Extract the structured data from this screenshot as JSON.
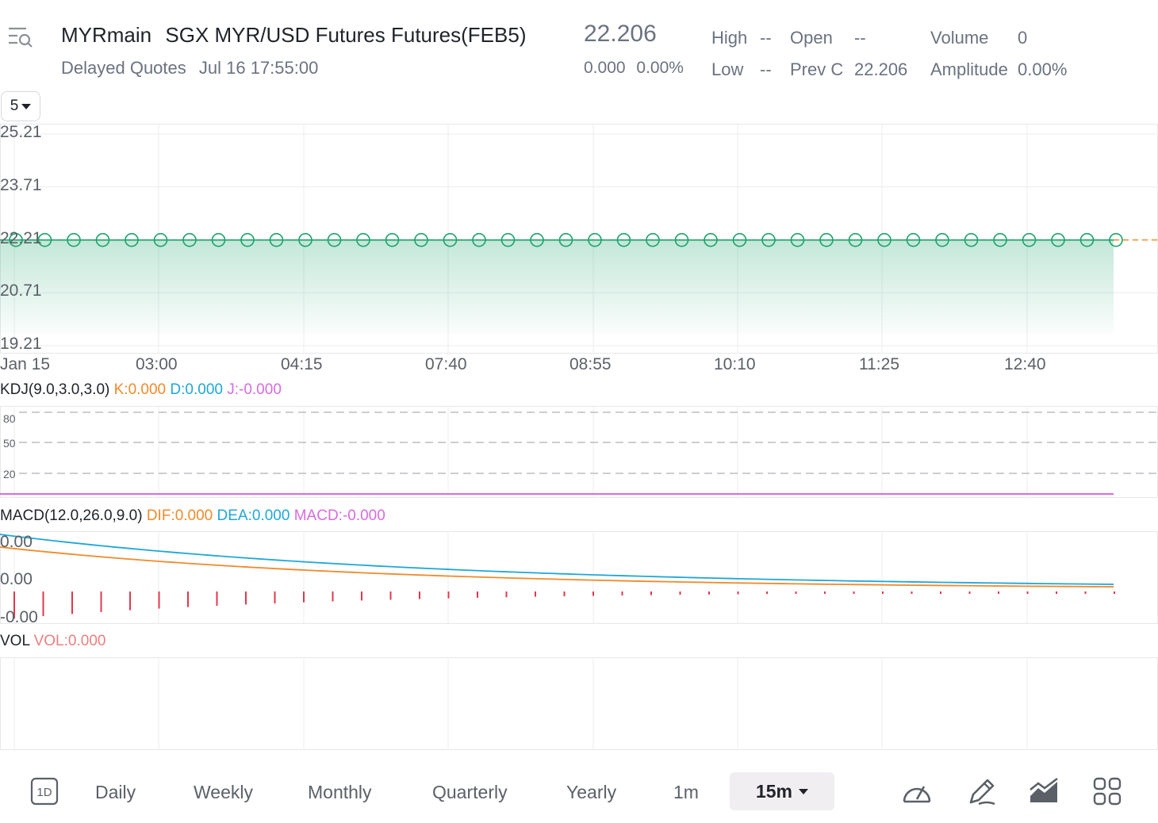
{
  "header": {
    "symbol": "MYRmain",
    "name": "SGX MYR/USD Futures Futures(FEB5)",
    "quote_type": "Delayed Quotes",
    "quote_time": "Jul 16 17:55:00",
    "last_price": "22.206",
    "change": "0.000",
    "change_pct": "0.00%",
    "stats": {
      "high_label": "High",
      "high_value": "--",
      "low_label": "Low",
      "low_value": "--",
      "open_label": "Open",
      "open_value": "--",
      "prev_close_label": "Prev C",
      "prev_close_value": "22.206",
      "volume_label": "Volume",
      "volume_value": "0",
      "amplitude_label": "Amplitude",
      "amplitude_value": "0.00%"
    }
  },
  "period_selector": {
    "value": "5"
  },
  "main_chart": {
    "y_ticks": [
      "25.21",
      "23.71",
      "22.21",
      "20.71",
      "19.21"
    ],
    "x_ticks": [
      "Jan 15",
      "03:00",
      "04:15",
      "07:40",
      "08:55",
      "10:10",
      "11:25",
      "12:40"
    ],
    "line_color": "#1aa36b",
    "prev_close_color": "#f08a2b"
  },
  "chart_data": [
    {
      "type": "line",
      "title": "",
      "x": [
        "Jan 15",
        "03:00",
        "04:15",
        "07:40",
        "08:55",
        "10:10",
        "11:25",
        "12:40"
      ],
      "series": [
        {
          "values": [
            22.206,
            22.206,
            22.206,
            22.206,
            22.206,
            22.206,
            22.206,
            22.206
          ]
        }
      ],
      "reference_line": 22.206,
      "ylim": [
        19.21,
        25.21
      ],
      "grid": true
    }
  ],
  "kdj": {
    "label": "KDJ(9.0,3.0,3.0)",
    "k": "K:0.000",
    "d": "D:0.000",
    "j": "J:-0.000",
    "k_color": "#f08a2b",
    "d_color": "#1fa7d8",
    "j_color": "#d86be0",
    "levels": [
      "80",
      "50",
      "20"
    ]
  },
  "macd": {
    "label": "MACD(12.0,26.0,9.0)",
    "dif": "DIF:0.000",
    "dea": "DEA:0.000",
    "macd": "MACD:-0.000",
    "dif_color": "#f08a2b",
    "dea_color": "#1fa7d8",
    "macd_color": "#d86be0",
    "y_ticks": [
      "0.00",
      "0.00",
      "-0.00"
    ]
  },
  "vol": {
    "label": "VOL",
    "vol": "VOL:0.000",
    "vol_color": "#e88080"
  },
  "toolbar": {
    "timeframes": [
      "Daily",
      "Weekly",
      "Monthly",
      "Quarterly",
      "Yearly",
      "1m"
    ],
    "selected": "15m",
    "icons": [
      "1d-icon",
      "speedometer-icon",
      "pencil-icon",
      "area-chart-icon",
      "grid-icon"
    ]
  }
}
